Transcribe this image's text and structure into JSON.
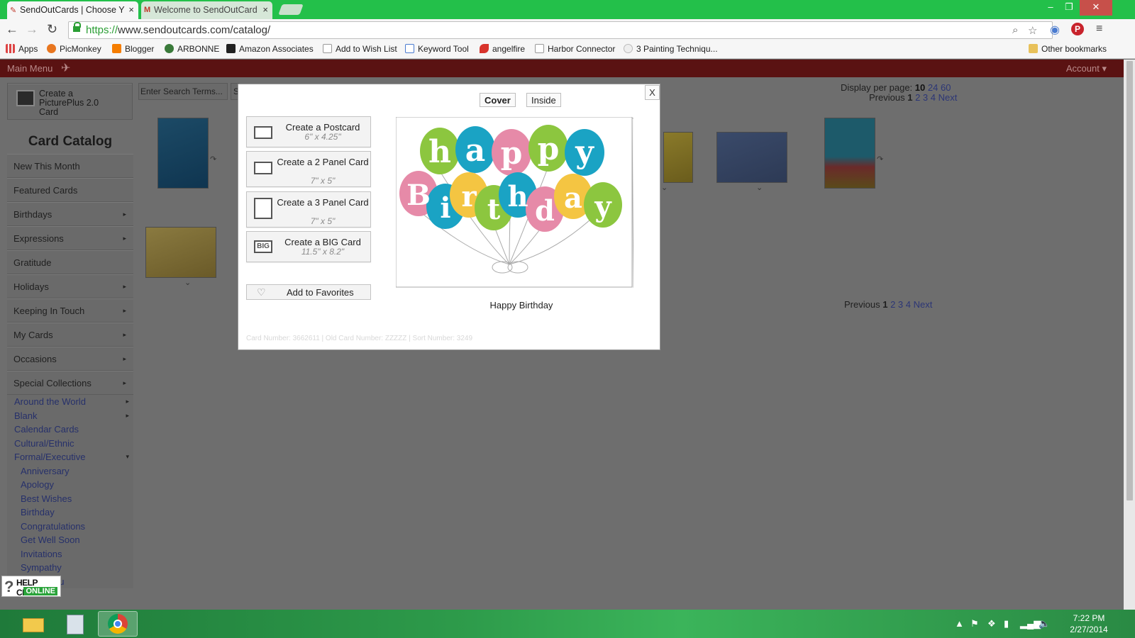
{
  "browser": {
    "tabs": [
      {
        "title": "SendOutCards | Choose Y",
        "active": true
      },
      {
        "title": "Welcome to SendOutCard",
        "active": false
      }
    ],
    "url_scheme": "https://",
    "url_rest": "www.sendoutcards.com/catalog/",
    "bookmarks": [
      {
        "label": "Apps",
        "icon": "apps-grid-icon"
      },
      {
        "label": "PicMonkey",
        "icon": "picmonkey-icon"
      },
      {
        "label": "Blogger",
        "icon": "blogger-icon"
      },
      {
        "label": "ARBONNE",
        "icon": "arbonne-icon"
      },
      {
        "label": "Amazon Associates",
        "icon": "amazon-icon"
      },
      {
        "label": "Add to Wish List",
        "icon": "page-icon"
      },
      {
        "label": "Keyword Tool",
        "icon": "google-icon"
      },
      {
        "label": "angelfire",
        "icon": "angelfire-icon"
      },
      {
        "label": "Harbor Connector",
        "icon": "page-icon"
      },
      {
        "label": "3 Painting Techniqu...",
        "icon": "site-icon"
      }
    ],
    "other_bookmarks": "Other bookmarks"
  },
  "site": {
    "main_menu": "Main Menu",
    "account": "Account ▾",
    "create_pictureplus": "Create a PicturePlus 2.0 Card",
    "catalog_title": "Card Catalog",
    "categories": [
      {
        "label": "New This Month",
        "arrow": false
      },
      {
        "label": "Featured Cards",
        "arrow": false
      },
      {
        "label": "Birthdays",
        "arrow": true
      },
      {
        "label": "Expressions",
        "arrow": true
      },
      {
        "label": "Gratitude",
        "arrow": false
      },
      {
        "label": "Holidays",
        "arrow": true
      },
      {
        "label": "Keeping In Touch",
        "arrow": true
      },
      {
        "label": "My Cards",
        "arrow": true
      },
      {
        "label": "Occasions",
        "arrow": true
      },
      {
        "label": "Special Collections",
        "arrow": true
      }
    ],
    "subcategories": [
      {
        "label": "Around the World",
        "level": 1,
        "arrow": "▸"
      },
      {
        "label": "Blank",
        "level": 1,
        "arrow": "▸"
      },
      {
        "label": "Calendar Cards",
        "level": 1,
        "arrow": ""
      },
      {
        "label": "Cultural/Ethnic",
        "level": 1,
        "arrow": ""
      },
      {
        "label": "Formal/Executive",
        "level": 1,
        "arrow": "▾"
      },
      {
        "label": "Anniversary",
        "level": 2,
        "arrow": ""
      },
      {
        "label": "Apology",
        "level": 2,
        "arrow": ""
      },
      {
        "label": "Best Wishes",
        "level": 2,
        "arrow": ""
      },
      {
        "label": "Birthday",
        "level": 2,
        "arrow": ""
      },
      {
        "label": "Congratulations",
        "level": 2,
        "arrow": ""
      },
      {
        "label": "Get Well Soon",
        "level": 2,
        "arrow": ""
      },
      {
        "label": "Invitations",
        "level": 2,
        "arrow": ""
      },
      {
        "label": "Sympathy",
        "level": 2,
        "arrow": ""
      },
      {
        "label": "Thank You",
        "level": 2,
        "arrow": ""
      }
    ],
    "search_placeholder": "Enter Search Terms...",
    "search_button": "S",
    "display_per_page_label": "Display per page:",
    "per_page_options": [
      "10",
      "24",
      "60"
    ],
    "per_page_selected": "10",
    "pager": {
      "previous": "Previous",
      "pages": [
        "1",
        "2",
        "3",
        "4"
      ],
      "current": "1",
      "next": "Next"
    },
    "help_chat": {
      "line1": "HELP CHAT",
      "line2": "ONLINE"
    }
  },
  "modal": {
    "tabs": [
      "Cover",
      "Inside"
    ],
    "selected_tab": "Cover",
    "close": "X",
    "options": [
      {
        "label": "Create a Postcard",
        "size": "6\" x 4.25\"",
        "icon": "postcard-icon"
      },
      {
        "label": "Create a 2 Panel Card",
        "size": "7\" x 5\"",
        "icon": "two-panel-card-icon"
      },
      {
        "label": "Create a 3 Panel Card",
        "size": "7\" x 5\"",
        "icon": "three-panel-card-icon"
      },
      {
        "label": "Create a BIG Card",
        "size": "11.5\" x 8.2\"",
        "icon": "big-card-icon"
      }
    ],
    "favorites": "Add to Favorites",
    "card_art_text": {
      "word1": "happy",
      "word2": "Birthday"
    },
    "card_name": "Happy Birthday",
    "card_info": "Card Number: 3662611 | Old Card Number: ZZZZZ | Sort Number: 3249"
  },
  "taskbar": {
    "time": "7:22 PM",
    "date": "2/27/2014"
  }
}
